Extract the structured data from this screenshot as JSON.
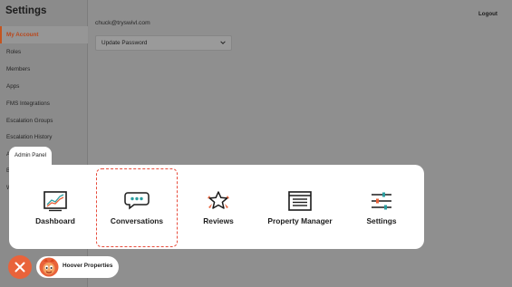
{
  "sidebar": {
    "title": "Settings",
    "items": [
      {
        "label": "My Account",
        "active": true
      },
      {
        "label": "Roles"
      },
      {
        "label": "Members"
      },
      {
        "label": "Apps"
      },
      {
        "label": "FMS Integrations"
      },
      {
        "label": "Escalation Groups"
      },
      {
        "label": "Escalation History"
      },
      {
        "label": "A"
      },
      {
        "label": "B"
      },
      {
        "label": "W"
      }
    ]
  },
  "header": {
    "logout_label": "Logout"
  },
  "account": {
    "email": "chuck@tryswivl.com",
    "password_select": "Update Password"
  },
  "admin_panel": {
    "tab_label": "Admin Panel",
    "tiles": [
      {
        "label": "Dashboard",
        "icon": "dashboard-chart-icon"
      },
      {
        "label": "Conversations",
        "icon": "chat-bubble-icon",
        "selected": true
      },
      {
        "label": "Reviews",
        "icon": "star-icon"
      },
      {
        "label": "Property Manager",
        "icon": "property-list-icon"
      },
      {
        "label": "Settings",
        "icon": "sliders-icon"
      }
    ]
  },
  "bottom_bar": {
    "close_icon": "close-icon",
    "property_name": "Hoover Properties"
  },
  "colors": {
    "accent": "#e9633b",
    "selected_outline": "#e74c3c",
    "active_sidebar": "#b9471c"
  }
}
